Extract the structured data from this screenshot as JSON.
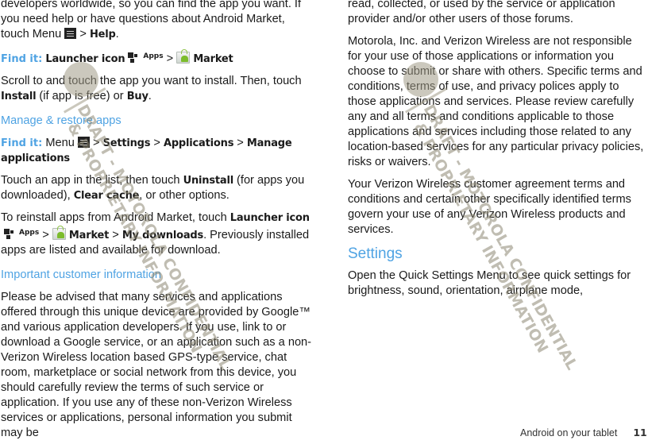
{
  "left_column": {
    "p1": [
      "developers worldwide, so you can find the app you want. If you need help or have questions about Android Market, touch Menu",
      " > ",
      "Help",
      "."
    ],
    "find1": {
      "label": "Find it:",
      "launcher": "Launcher icon",
      "apps": "Apps",
      "sep": " > ",
      "market": "Market"
    },
    "p2": [
      "Scroll to and touch the app you want to install. Then, touch ",
      "Install",
      " (if app is free) or ",
      "Buy",
      "."
    ],
    "heading_manage": "Manage & restore apps",
    "find2": {
      "label": "Find it:",
      "menu": " Menu ",
      "sep": " > ",
      "settings": "Settings",
      "applications": "Applications",
      "manage": "Manage applications"
    },
    "p3": [
      "Touch an app in the list, then touch ",
      "Uninstall",
      " (for apps you downloaded), ",
      "Clear cache",
      ", or other options."
    ],
    "p4": [
      "To reinstall apps from Android Market, touch ",
      "Launcher icon",
      "Apps",
      " > ",
      "Market",
      " > ",
      "My downloads",
      ". Previously installed apps are listed and available for download."
    ],
    "heading_important": "Important customer information",
    "p5": "Please be advised that many services and applications offered through this unique device are provided by Google™ and various application developers. If you use, link to or download a Google service, or an application such as a non-Verizon Wireless location based GPS-type service, chat room, marketplace or social network from this device, you should carefully review the terms of such service or application. If you use any of these non-Verizon Wireless services or applications, personal information you submit may be"
  },
  "right_column": {
    "p1": "read, collected, or used by the service or application provider and/or other users of those forums.",
    "p2": "Motorola, Inc. and Verizon Wireless are not responsible for your use of those applications or information you choose to submit or share with others. Specific terms and conditions, terms of use, and privacy polices apply to those applications and services. Please review carefully any and all terms and conditions applicable to those applications and services including those related to any location-based services for any particular privacy policies, risks or waivers.",
    "p3": "Your Verizon Wireless customer agreement terms and conditions and certain other specifically identified terms govern your use of any Verizon Wireless products and services.",
    "heading_settings": "Settings",
    "p4": "Open the Quick Settings Menu to see quick settings for brightness, sound, orientation, airplane mode,"
  },
  "footer": {
    "section": "Android on your tablet",
    "page_number": "11"
  },
  "watermark": {
    "line1": "DRAFT - MOTOROLA CONFIDENTIAL",
    "line2": "& PROPRIETARY INFORMATION"
  },
  "colors": {
    "accent": "#4fa3e3",
    "text": "#1a1a1a"
  }
}
